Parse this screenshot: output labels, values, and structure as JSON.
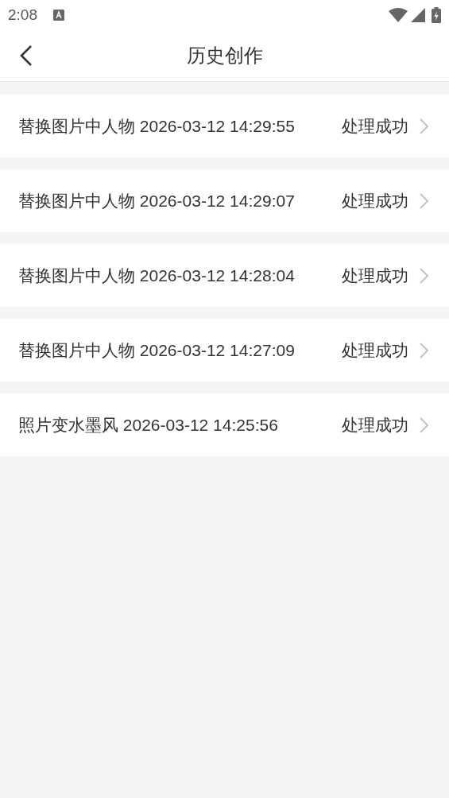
{
  "status_bar": {
    "time": "2:08"
  },
  "header": {
    "title": "历史创作"
  },
  "records": [
    {
      "title": "替换图片中人物 2026-03-12 14:29:55",
      "status": "处理成功"
    },
    {
      "title": "替换图片中人物 2026-03-12 14:29:07",
      "status": "处理成功"
    },
    {
      "title": "替换图片中人物 2026-03-12 14:28:04",
      "status": "处理成功"
    },
    {
      "title": "替换图片中人物 2026-03-12 14:27:09",
      "status": "处理成功"
    },
    {
      "title": "照片变水墨风 2026-03-12 14:25:56",
      "status": "处理成功"
    }
  ]
}
